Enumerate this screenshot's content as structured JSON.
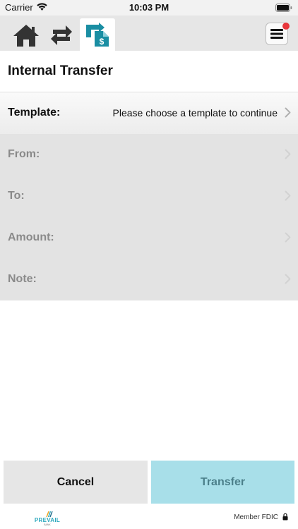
{
  "status_bar": {
    "carrier": "Carrier",
    "time": "10:03 PM"
  },
  "tabs": [
    {
      "name": "home",
      "icon": "home-icon"
    },
    {
      "name": "transfers",
      "icon": "transfer-arrows-icon"
    },
    {
      "name": "internal-transfer",
      "icon": "internal-transfer-icon",
      "active": true
    }
  ],
  "menu": {
    "icon": "hamburger-menu-icon",
    "has_notification": true
  },
  "page": {
    "title": "Internal Transfer"
  },
  "form": {
    "template": {
      "label": "Template:",
      "value": "Please choose a template to continue"
    },
    "from": {
      "label": "From:"
    },
    "to": {
      "label": "To:"
    },
    "amount": {
      "label": "Amount:"
    },
    "note": {
      "label": "Note:"
    }
  },
  "buttons": {
    "cancel": "Cancel",
    "transfer": "Transfer"
  },
  "footer": {
    "logo_text": "PREVAIL",
    "logo_sub": "BANK",
    "member": "Member FDIC"
  },
  "colors": {
    "accent": "#1a8ea3",
    "transfer_button": "#a8dfe9",
    "notification": "#e8363c"
  }
}
